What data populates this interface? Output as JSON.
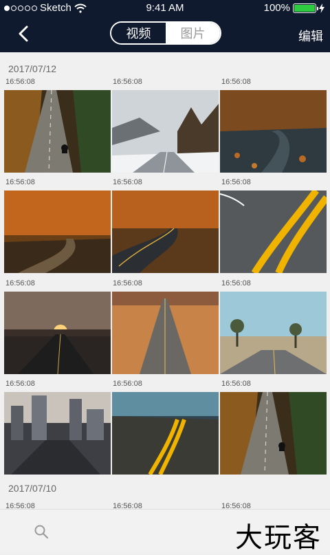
{
  "status_bar": {
    "carrier": "Sketch",
    "time": "9:41 AM",
    "battery": "100%",
    "battery_level": 1.0
  },
  "nav": {
    "segments": [
      "视频",
      "图片"
    ],
    "active_segment": "视频",
    "edit_label": "编辑"
  },
  "groups": [
    {
      "date": "2017/07/12",
      "items": [
        {
          "time": "16:56:08",
          "scene": "forest-road-motorcycle"
        },
        {
          "time": "16:56:08",
          "scene": "snowy-mountain-road"
        },
        {
          "time": "16:56:08",
          "scene": "autumn-leaves-road"
        },
        {
          "time": "16:56:08",
          "scene": "autumn-wet-road"
        },
        {
          "time": "16:56:08",
          "scene": "autumn-curve-road"
        },
        {
          "time": "16:56:08",
          "scene": "yellow-line-curve"
        },
        {
          "time": "16:56:08",
          "scene": "sunset-road"
        },
        {
          "time": "16:56:08",
          "scene": "desert-road"
        },
        {
          "time": "16:56:08",
          "scene": "joshua-tree-road"
        },
        {
          "time": "16:56:08",
          "scene": "city-street"
        },
        {
          "time": "16:56:08",
          "scene": "coastal-road"
        },
        {
          "time": "16:56:08",
          "scene": "forest-road-motorcycle-2"
        }
      ]
    },
    {
      "date": "2017/07/10",
      "items": [
        {
          "time": "16:56:08",
          "scene": "forest-road-motorcycle"
        },
        {
          "time": "16:56:08",
          "scene": "snowy-mountain-road"
        },
        {
          "time": "16:56:08",
          "scene": "autumn-leaves-road"
        }
      ]
    }
  ],
  "bottom_bar": {
    "search_icon": "search-icon",
    "logo_text": "大玩客"
  },
  "colors": {
    "header_bg": "#101a2e",
    "battery_green": "#2ecc40",
    "page_bg": "#f0f0f0"
  }
}
